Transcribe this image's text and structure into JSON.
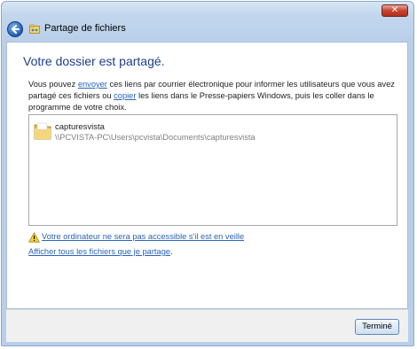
{
  "window": {
    "title": "Partage de fichiers",
    "close_label": "✕"
  },
  "main": {
    "heading": "Votre dossier est partagé.",
    "desc": {
      "part1": "Vous pouvez ",
      "link_envoyer": "envoyer",
      "part2": " ces liens par courrier électronique pour informer les utilisateurs que vous avez partagé ces fichiers ou ",
      "link_copier": "copier",
      "part3": " les liens dans le Presse-papiers Windows, puis les coller dans le programme de votre choix."
    },
    "share_item": {
      "name": "capturesvista",
      "path": "\\\\PCVISTA-PC\\Users\\pcvista\\Documents\\capturesvista"
    },
    "warning_link": "Votre ordinateur ne sera pas accessible s'il est en veille",
    "all_files_link": "Afficher tous les fichiers que je partage",
    "all_files_suffix": "."
  },
  "footer": {
    "done_label": "Terminé"
  },
  "colors": {
    "heading": "#1e3e8c",
    "link": "#2a64b8",
    "path_text": "#808080"
  },
  "icons": {
    "back": "back-arrow-icon",
    "window": "share-folder-icon",
    "folder": "folder-icon",
    "warning": "warning-icon"
  }
}
